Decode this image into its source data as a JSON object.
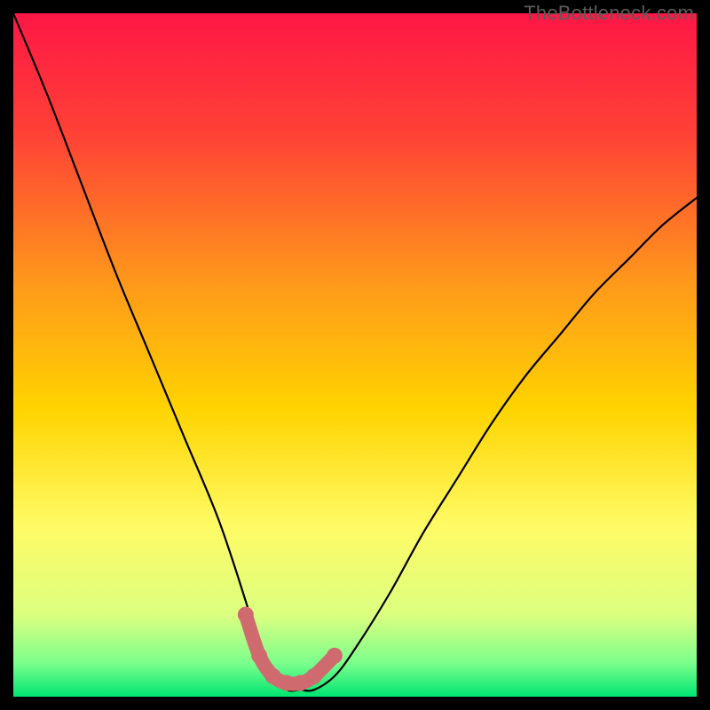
{
  "watermark": "TheBottleneck.com",
  "chart_data": {
    "type": "line",
    "title": "",
    "xlabel": "",
    "ylabel": "",
    "xlim": [
      0,
      100
    ],
    "ylim": [
      0,
      100
    ],
    "series": [
      {
        "name": "bottleneck-curve",
        "x": [
          0,
          5,
          10,
          15,
          20,
          25,
          30,
          34,
          36,
          38,
          40,
          42,
          44,
          47,
          50,
          55,
          60,
          65,
          70,
          75,
          80,
          85,
          90,
          95,
          100
        ],
        "values": [
          100,
          88,
          75,
          62,
          50,
          38,
          26,
          14,
          7,
          3,
          1,
          1,
          1,
          3,
          7,
          15,
          24,
          32,
          40,
          47,
          53,
          59,
          64,
          69,
          73
        ]
      },
      {
        "name": "optimal-zone-marker",
        "x": [
          34,
          36,
          38,
          40,
          42,
          44,
          47
        ],
        "values": [
          12,
          6,
          3,
          2,
          2,
          3,
          6
        ]
      }
    ],
    "gradient_stops": [
      {
        "pos": 0.0,
        "color": "#ff1746"
      },
      {
        "pos": 0.18,
        "color": "#ff4236"
      },
      {
        "pos": 0.4,
        "color": "#ff9a1a"
      },
      {
        "pos": 0.58,
        "color": "#ffd400"
      },
      {
        "pos": 0.75,
        "color": "#fffb66"
      },
      {
        "pos": 0.88,
        "color": "#dcff80"
      },
      {
        "pos": 0.95,
        "color": "#7dff8c"
      },
      {
        "pos": 1.0,
        "color": "#00e572"
      }
    ],
    "marker_color": "#cf6b6e",
    "curve_color": "#000000"
  }
}
